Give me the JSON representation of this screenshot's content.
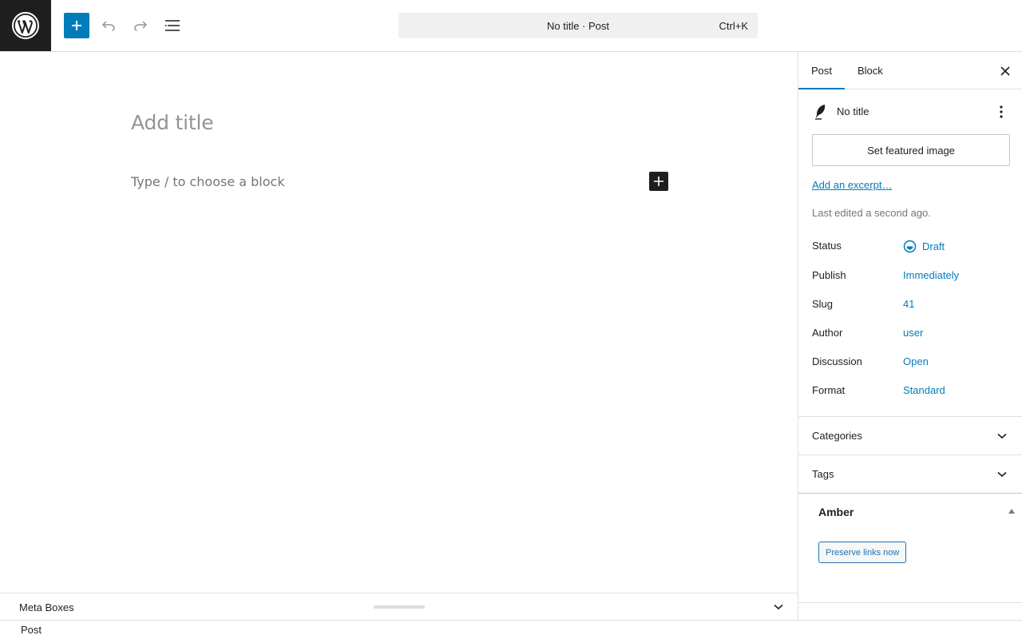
{
  "header": {
    "logo_icon": "wordpress-logo-icon",
    "add_block_icon": "plus-icon",
    "undo_icon": "undo-icon",
    "redo_icon": "redo-icon",
    "list_view_icon": "list-view-icon",
    "command_title": "No title · Post",
    "command_shortcut": "Ctrl+K"
  },
  "editor": {
    "title_placeholder": "Add title",
    "block_placeholder": "Type / to choose a block",
    "inline_add_icon": "plus-icon"
  },
  "sidebar": {
    "tabs": [
      {
        "label": "Post",
        "active": true
      },
      {
        "label": "Block",
        "active": false
      }
    ],
    "close_icon": "close-icon",
    "post_icon": "quill-icon",
    "post_title": "No title",
    "more_icon": "more-vertical-icon",
    "featured_image_label": "Set featured image",
    "excerpt_link": "Add an excerpt…",
    "last_edited": "Last edited a second ago.",
    "meta": {
      "status": {
        "label": "Status",
        "value": "Draft"
      },
      "publish": {
        "label": "Publish",
        "value": "Immediately"
      },
      "slug": {
        "label": "Slug",
        "value": "41"
      },
      "author": {
        "label": "Author",
        "value": "user"
      },
      "discussion": {
        "label": "Discussion",
        "value": "Open"
      },
      "format": {
        "label": "Format",
        "value": "Standard"
      }
    },
    "panels": {
      "categories": "Categories",
      "tags": "Tags"
    },
    "amber": {
      "title": "Amber",
      "button": "Preserve links now"
    }
  },
  "metaboxes": {
    "title": "Meta Boxes"
  },
  "footer": {
    "breadcrumb": "Post"
  },
  "colors": {
    "accent": "#007cba",
    "dark": "#1e1e1e",
    "border": "#e0e0e0"
  }
}
